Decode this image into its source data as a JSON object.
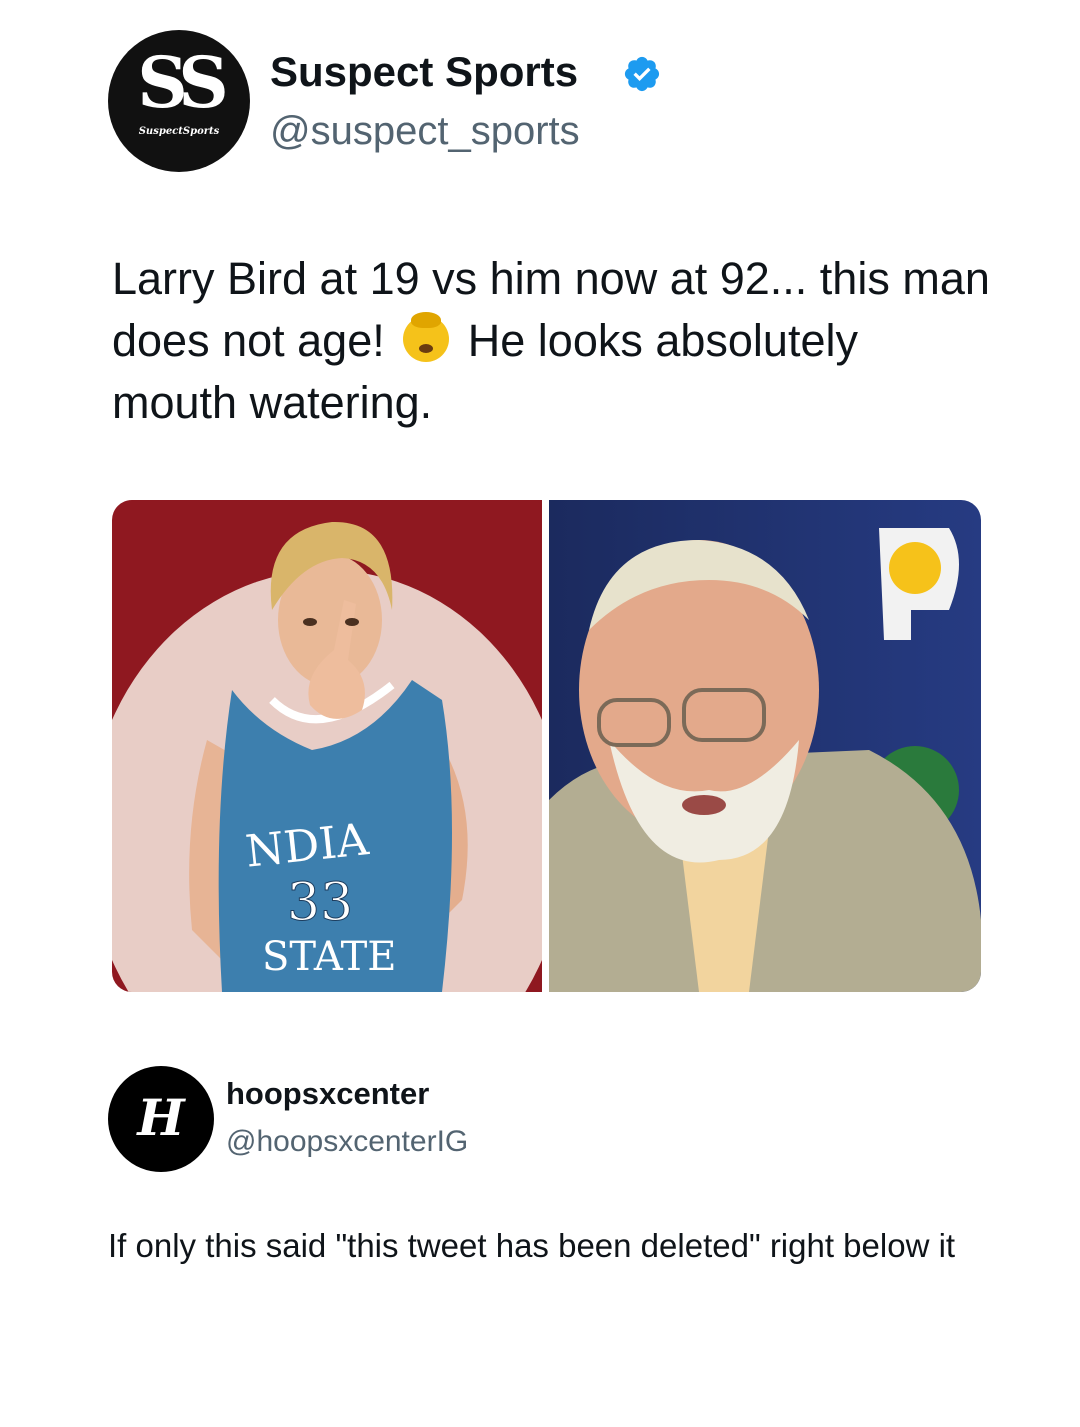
{
  "tweet": {
    "author": {
      "avatar_letters": "SS",
      "avatar_brand": "SuspectSports",
      "name": "Suspect Sports",
      "verified": true,
      "handle": "@suspect_sports"
    },
    "text_part1": "Larry Bird at 19 vs him now at 92... this man does not age!",
    "emoji": "exploding-head",
    "text_part2": "He looks absolutely mouth watering.",
    "images": [
      {
        "id": "young",
        "jersey_text": "NDIA",
        "jersey_number": "33",
        "jersey_text2": "STATE"
      },
      {
        "id": "old"
      }
    ]
  },
  "reply": {
    "author": {
      "avatar_letter": "H",
      "name": "hoopsxcenter",
      "handle": "@hoopsxcenterIG"
    },
    "text": "If only this said \"this tweet has been deleted\" right below it"
  },
  "colors": {
    "verified_blue": "#1d9bf0",
    "handle_gray": "#536471"
  },
  "icons": [
    "verified-badge-icon",
    "exploding-head-emoji"
  ]
}
